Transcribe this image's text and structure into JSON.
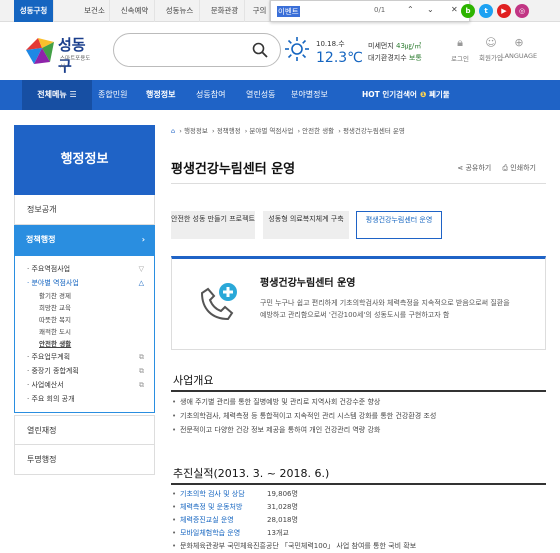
{
  "topbar": {
    "tabs": [
      "성동구청",
      "보건소",
      "신속예약",
      "성동뉴스",
      "문화관광",
      "구의"
    ],
    "find": {
      "query": "이벤트",
      "count": "0/1"
    },
    "social": [
      {
        "name": "blog",
        "letter": "b",
        "color": "#2db400"
      },
      {
        "name": "twitter",
        "letter": "t",
        "color": "#1da1f2"
      },
      {
        "name": "youtube",
        "letter": "▶",
        "color": "#e02020"
      },
      {
        "name": "instagram",
        "letter": "◎",
        "color": "#c13584"
      }
    ]
  },
  "header": {
    "logo": {
      "name": "성동구",
      "tagline": "스마트포용도시"
    },
    "weather": {
      "date": "10.18.수",
      "temp": "12.3℃"
    },
    "air": {
      "label": "미세먼지",
      "value": "43㎍/㎥",
      "index_label": "대기환경지수",
      "index_value": "보통"
    },
    "util": [
      "로그인",
      "회원가입",
      "LANGUAGE"
    ]
  },
  "nav": {
    "all_menu": "전체메뉴",
    "items": [
      "종합민원",
      "행정정보",
      "성동참여",
      "열린성동",
      "분야별정보"
    ],
    "hot_label": "HOT 인기검색어",
    "hot_keyword": "폐기물"
  },
  "sidebar": {
    "title": "행정정보",
    "items": [
      "정보공개",
      "열린재정",
      "투명행정"
    ],
    "active": "정책행정",
    "sub": [
      {
        "label": "주요역점사업",
        "children": []
      },
      {
        "label": "분야별 역점사업",
        "children": [
          "활기찬 경제",
          "희망찬 교육",
          "따뜻한 복지",
          "쾌적한 도시",
          "안전한 생활"
        ]
      },
      {
        "label": "주요업무계획",
        "children": []
      },
      {
        "label": "중장기 종합계획",
        "children": []
      },
      {
        "label": "사업예산서",
        "children": []
      },
      {
        "label": "주요 회의 공개",
        "children": []
      }
    ]
  },
  "breadcrumb": [
    "행정정보",
    "정책행정",
    "분야별 역점사업",
    "안전한 생활",
    "평생건강누림센터 운영"
  ],
  "page": {
    "title": "평생건강누림센터 운영",
    "share": "공유하기",
    "print": "인쇄하기"
  },
  "tabs": [
    "안전한 성동 만들기 프로젝트",
    "성동형 의료복지체계 구축",
    "평생건강누림센터 운영"
  ],
  "intro": {
    "heading": "평생건강누림센터 운영",
    "desc": "구민 누구나 쉽고 편리하게 기초의학검사와 체력측정을 지속적으로 받음으로써 질환을 예방하고 관리함으로써 '건강100세'의 성동도시를 구현하고자 함"
  },
  "overview": {
    "title": "사업개요",
    "items": [
      "생애 주기별 관리를 통한 질병예방 및 관리로 지역사회 건강수준 향상",
      "기초의학검사, 체력측정 등 통합적이고 지속적인 관리 시스템 강화를 통한 건강환경 조성",
      "전문적이고 다양한 건강 정보 제공을 통하여 개인 건강관리 역량 강화"
    ]
  },
  "achievements": {
    "title": "추진실적(2013. 3. ~ 2018. 6.)",
    "items": [
      {
        "label": "기초의학 검사 및 상담",
        "value": "19,806명"
      },
      {
        "label": "체력측정 및 운동처방",
        "value": "31,028명"
      },
      {
        "label": "체력증진교실 운영",
        "value": "28,018명"
      },
      {
        "label": "모바일체험학습 운영",
        "value": "13개교"
      },
      {
        "label": "",
        "value": "문화체육관광부 국민체육진흥공단 「국민체력100」 사업 참여를 통한 국비 확보"
      }
    ]
  }
}
